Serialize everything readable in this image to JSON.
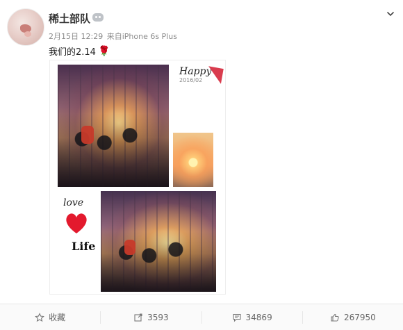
{
  "post": {
    "username": "稀土部队",
    "time": "2月15日 12:29",
    "source": "来自iPhone 6s Plus",
    "text": "我们的2.14",
    "text_icon": "rose-emoji",
    "collage": {
      "happy_text": "Happy",
      "date_text": "2016/02",
      "love_text": "love",
      "life_text": "Life"
    }
  },
  "actions": {
    "favorite_label": "收藏",
    "repost_count": "3593",
    "comment_count": "34869",
    "like_count": "267950"
  },
  "icons": {
    "menu": "chevron-down-icon",
    "favorite": "star-icon",
    "repost": "share-icon",
    "comment": "comment-icon",
    "like": "thumbs-up-icon"
  }
}
